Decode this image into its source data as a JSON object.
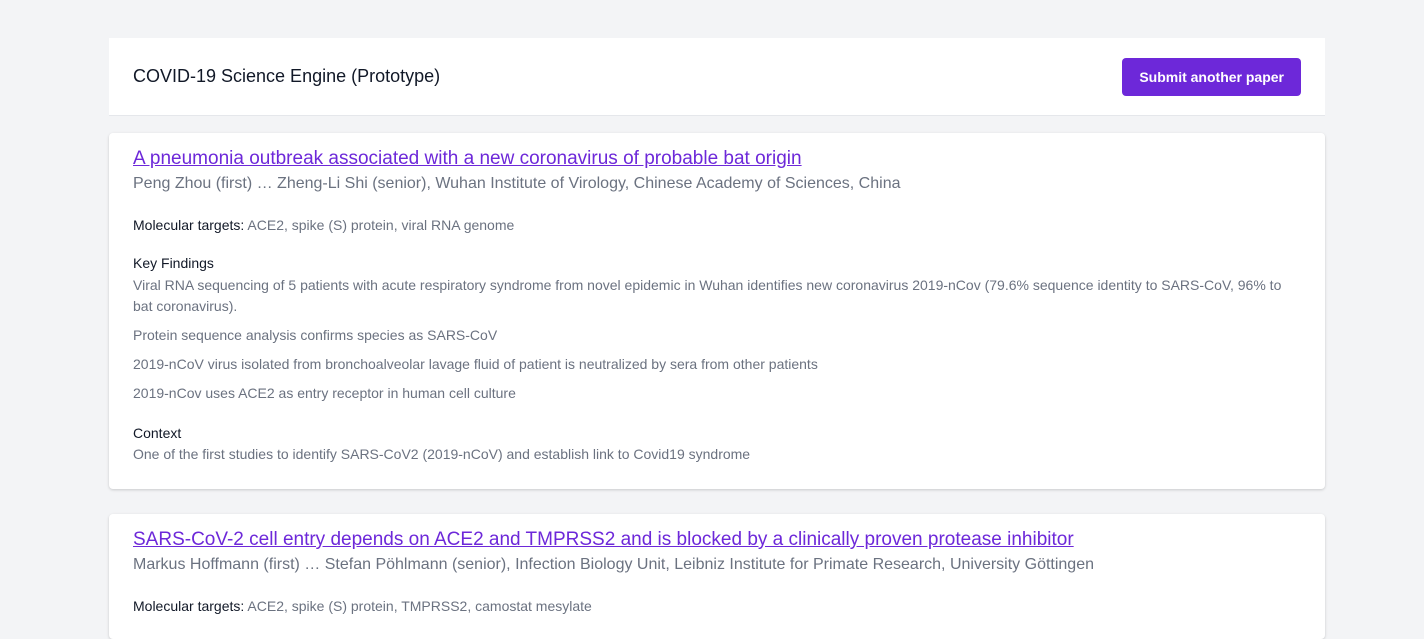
{
  "header": {
    "title": "COVID-19 Science Engine (Prototype)",
    "submit_label": "Submit another paper"
  },
  "papers": [
    {
      "title": "A pneumonia outbreak associated with a new coronavirus of probable bat origin",
      "authors": "Peng Zhou (first) … Zheng-Li Shi (senior), Wuhan Institute of Virology, Chinese Academy of Sciences, China",
      "targets_label": "Molecular targets:",
      "targets": "ACE2, spike (S) protein, viral RNA genome",
      "findings_heading": "Key Findings",
      "findings": [
        "Viral RNA sequencing of 5 patients with acute respiratory syndrome from novel epidemic in Wuhan identifies new coronavirus 2019-nCov (79.6% sequence identity to SARS-CoV, 96% to bat coronavirus).",
        "Protein sequence analysis confirms species as SARS-CoV",
        "2019-nCoV virus isolated from bronchoalveolar lavage fluid of patient is neutralized by sera from other patients",
        "2019-nCov uses ACE2 as entry receptor in human cell culture"
      ],
      "context_heading": "Context",
      "context": "One of the first studies to identify SARS-CoV2 (2019-nCoV) and establish link to Covid19 syndrome"
    },
    {
      "title": "SARS-CoV-2 cell entry depends on ACE2 and TMPRSS2 and is blocked by a clinically proven protease inhibitor",
      "authors": "Markus Hoffmann (first) … Stefan Pöhlmann (senior), Infection Biology Unit, Leibniz Institute for Primate Research, University Göttingen",
      "targets_label": "Molecular targets:",
      "targets": "ACE2, spike (S) protein, TMPRSS2, camostat mesylate"
    }
  ],
  "colors": {
    "accent": "#6d28d9",
    "background": "#f3f4f6",
    "muted_text": "#6b7280"
  }
}
